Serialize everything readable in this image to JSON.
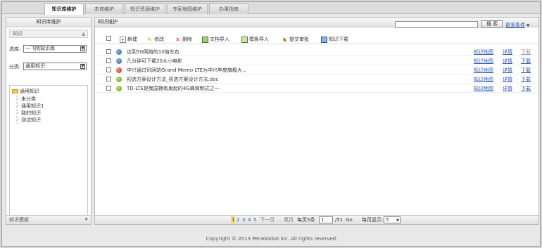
{
  "tabs": [
    "知识库维护",
    "本体维护",
    "知识资源维护",
    "专家地图维护",
    "办事指南"
  ],
  "sidebar": {
    "title": "知识库维护",
    "section": "知识",
    "lib_label": "选库:",
    "lib_value": "一飞院知识库",
    "cat_label": "分类:",
    "cat_value": "通用知识",
    "tree": [
      "通用知识",
      "未分类",
      "通用知识1",
      "我的知识",
      "测试知识"
    ],
    "footer": "知识模板"
  },
  "main": {
    "title": "知识维护",
    "search_button": "搜 索",
    "more_conditions": "更多条件",
    "toolbar": [
      "新建",
      "修改",
      "删除",
      "文档导入",
      "模板导入",
      "提交审批",
      "知识下载"
    ],
    "actions": [
      "知识地图",
      "详情",
      "下载"
    ],
    "rows": [
      {
        "status": "blue",
        "title": "达到5G网络的10倍左右"
      },
      {
        "status": "blue",
        "title": "几分钟可下载20大小电影"
      },
      {
        "status": "red",
        "title": "中兴通过讯网站Grand Memo LTE为中兴年度旗舰大..."
      },
      {
        "status": "green",
        "title": "初选方案设计方法_初选方案设计方法.doc"
      },
      {
        "status": "green",
        "title": "TD-LTE是我国拥有发起的4G蜂窝制式之一"
      }
    ]
  },
  "pager": {
    "current": "1",
    "pages": [
      "2",
      "3",
      "4",
      "5"
    ],
    "next": "下一页",
    "last": "尾页",
    "per_page_label": "每页5条",
    "page_input": "1",
    "total": "/51",
    "go": "Go",
    "show_label": "每页显示:",
    "show_value": "5"
  },
  "footer": "Copyright © 2013 PeraGlobal Inc. All rights reserved."
}
